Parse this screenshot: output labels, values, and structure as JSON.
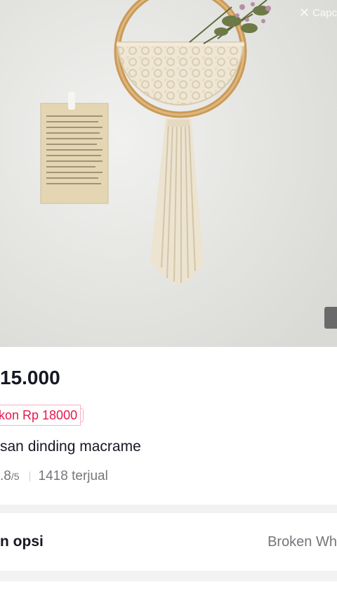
{
  "hero": {
    "watermark_text": "Capc",
    "watermark_icon": "capcut-logo-icon",
    "image_subject": "macrame-wall-hanging-photo"
  },
  "product": {
    "price": "15.000",
    "discount_label": "kon Rp 18000",
    "title": "san dinding macrame",
    "rating": ".8",
    "rating_outof": "/5",
    "sold": "1418 terjual"
  },
  "options": {
    "label": "n opsi",
    "value": "Broken Wh"
  },
  "colors": {
    "price_text": "#161823",
    "discount_accent": "#e8174d",
    "muted_text": "#75767b",
    "page_bg": "#f2f2f2"
  }
}
